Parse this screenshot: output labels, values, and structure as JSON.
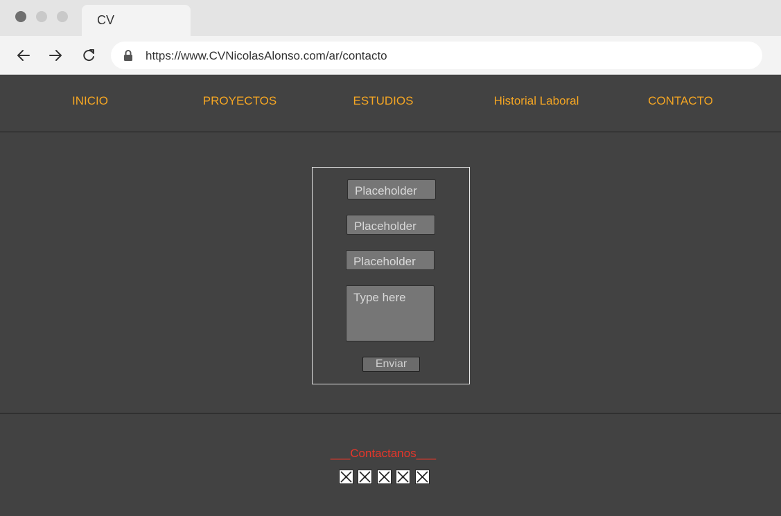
{
  "browser": {
    "tab_title": "CV",
    "url": "https://www.CVNicolasAlonso.com/ar/contacto",
    "icons": {
      "back": "arrow-left-icon",
      "forward": "arrow-right-icon",
      "reload": "reload-icon",
      "lock": "lock-icon"
    }
  },
  "nav": {
    "items": [
      {
        "label": "INICIO"
      },
      {
        "label": "PROYECTOS"
      },
      {
        "label": "ESTUDIOS"
      },
      {
        "label": "Historial Laboral"
      },
      {
        "label": "CONTACTO"
      }
    ],
    "color": "#f5a623"
  },
  "form": {
    "fields": [
      {
        "placeholder": "Placeholder",
        "value": ""
      },
      {
        "placeholder": "Placeholder",
        "value": ""
      },
      {
        "placeholder": "Placeholder",
        "value": ""
      }
    ],
    "message": {
      "placeholder": "Type here",
      "value": ""
    },
    "submit_label": "Enviar"
  },
  "footer": {
    "title": "___Contactanos___",
    "title_color": "#e8362a",
    "social_icons": [
      "broken-image-icon",
      "broken-image-icon",
      "broken-image-icon",
      "broken-image-icon",
      "broken-image-icon"
    ]
  },
  "colors": {
    "background": "#424242",
    "accent": "#f5a623"
  }
}
